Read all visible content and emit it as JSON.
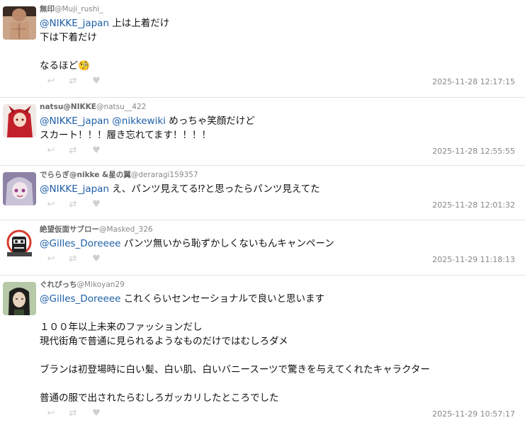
{
  "replies": [
    {
      "name": "無印",
      "handle": "@Muji_rushi_",
      "lines": [
        {
          "mention": "@NIKKE_japan",
          "text": " 上は上着だけ"
        },
        {
          "mention": "",
          "text": "下は下着だけ"
        },
        {
          "mention": "",
          "text": ""
        },
        {
          "mention": "",
          "text": "なるほど🧐"
        }
      ],
      "time": "2025-11-28 12:17:15"
    },
    {
      "name": "natsu@NIKKE",
      "handle": "@natsu__422",
      "lines": [
        {
          "mention": "@NIKKE_japan @nikkewiki",
          "text": " めっちゃ笑顔だけど"
        },
        {
          "mention": "",
          "text": "スカート！！！履き忘れてます！！！！"
        }
      ],
      "time": "2025-11-28 12:55:55"
    },
    {
      "name": "でららぎ@nikke &星の翼",
      "handle": "@deraragi159357",
      "lines": [
        {
          "mention": "@NIKKE_japan",
          "text": " え、パンツ見えてる⁉と思ったらパンツ見えてた"
        }
      ],
      "time": "2025-11-28 12:01:32"
    },
    {
      "name": "絶望仮面サブロー",
      "handle": "@Masked_326",
      "lines": [
        {
          "mention": "@Gilles_Doreeee",
          "text": " パンツ無いから恥ずかしくないもんキャンペーン"
        }
      ],
      "time": "2025-11-29 11:18:13"
    },
    {
      "name": "ぐれぴっち",
      "handle": "@Mikoyan29",
      "lines": [
        {
          "mention": "@Gilles_Doreeee",
          "text": " これくらいセンセーショナルで良いと思います"
        },
        {
          "mention": "",
          "text": ""
        },
        {
          "mention": "",
          "text": "１００年以上未来のファッションだし"
        },
        {
          "mention": "",
          "text": "現代街角で普通に見られるようなものだけではむしろダメ"
        },
        {
          "mention": "",
          "text": ""
        },
        {
          "mention": "",
          "text": "ブランは初登場時に白い髪、白い肌、白いバニースーツで驚きを与えてくれたキャラクター"
        },
        {
          "mention": "",
          "text": ""
        },
        {
          "mention": "",
          "text": "普通の服で出されたらむしろガッカリしたところでした"
        }
      ],
      "time": "2025-11-29 10:57:17"
    }
  ],
  "icons": {
    "reply": "reply-icon",
    "retweet": "retweet-icon",
    "like": "heart-icon"
  },
  "colors": {
    "mention": "#1d5fa8",
    "meta": "#888888",
    "icon": "#cfcfcf",
    "divider": "#e2e2e2"
  }
}
